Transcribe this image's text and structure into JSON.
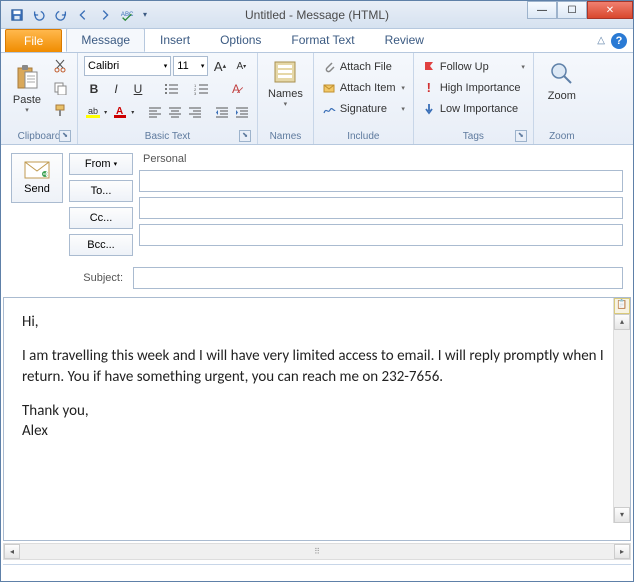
{
  "window": {
    "title": "Untitled  -  Message (HTML)"
  },
  "tabs": {
    "file": "File",
    "message": "Message",
    "insert": "Insert",
    "options": "Options",
    "format": "Format Text",
    "review": "Review"
  },
  "ribbon": {
    "clipboard": {
      "paste": "Paste",
      "label": "Clipboard"
    },
    "font": {
      "name": "Calibri",
      "size": "11",
      "label": "Basic Text"
    },
    "names": {
      "btn": "Names",
      "label": "Names"
    },
    "include": {
      "attach_file": "Attach File",
      "attach_item": "Attach Item",
      "signature": "Signature",
      "label": "Include"
    },
    "tags": {
      "follow_up": "Follow Up",
      "high": "High Importance",
      "low": "Low Importance",
      "label": "Tags"
    },
    "zoom": {
      "btn": "Zoom",
      "label": "Zoom"
    }
  },
  "compose": {
    "send": "Send",
    "from": "From",
    "account": "Personal",
    "to": "To...",
    "cc": "Cc...",
    "bcc": "Bcc...",
    "subject_label": "Subject:",
    "subject_value": ""
  },
  "body": {
    "greeting": "Hi,",
    "para1": "I am travelling this week and I will have very limited access to email. I will reply promptly when I return. You if have something urgent, you can reach me on 232-7656.",
    "thanks": "Thank you,",
    "name": "Alex"
  }
}
